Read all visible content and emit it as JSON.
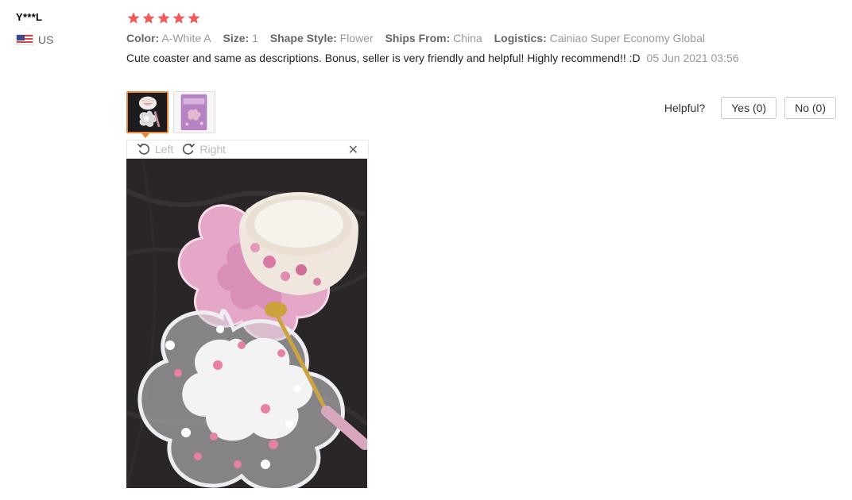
{
  "reviewer": {
    "name": "Y***L",
    "country": "US"
  },
  "rating": {
    "stars": 5,
    "max": 5,
    "color": "#f05a5a"
  },
  "attributes": [
    {
      "key": "Color:",
      "value": "A-White A"
    },
    {
      "key": "Size:",
      "value": "1"
    },
    {
      "key": "Shape Style:",
      "value": "Flower"
    },
    {
      "key": "Ships From:",
      "value": "China"
    },
    {
      "key": "Logistics:",
      "value": "Cainiao Super Economy Global"
    }
  ],
  "review": {
    "text": "Cute coaster and same as descriptions. Bonus, seller is very friendly and helpful! Highly recommend!! :D",
    "date": "05 Jun 2021 03:56"
  },
  "helpful": {
    "label": "Helpful?",
    "yes": "Yes (0)",
    "no": "No (0)"
  },
  "viewer": {
    "rotate_left": "Left",
    "rotate_right": "Right",
    "close": "✕"
  },
  "theme": {
    "accent": "#e8863a"
  }
}
